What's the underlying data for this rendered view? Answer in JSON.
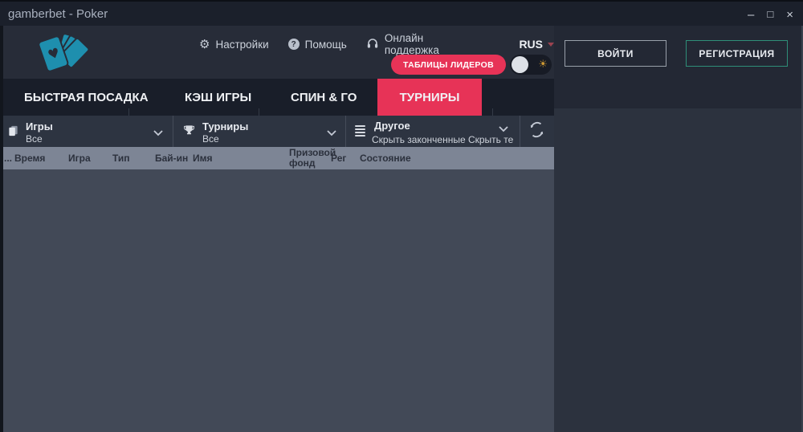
{
  "window": {
    "title": "gamberbet - Poker",
    "controls": {
      "minimize": "–",
      "maximize": "□",
      "close": "×"
    }
  },
  "header": {
    "menu": [
      {
        "icon": "gear-icon",
        "label": "Настройки"
      },
      {
        "icon": "help-icon",
        "help_glyph": "?",
        "label": "Помощь"
      },
      {
        "icon": "headset-icon",
        "label": "Онлайн поддержка"
      }
    ],
    "language": "RUS",
    "leaderboards_label": "ТАБЛИЦЫ ЛИДЕРОВ",
    "login_label": "ВОЙТИ",
    "register_label": "РЕГИСТРАЦИЯ"
  },
  "nav": {
    "tabs": [
      {
        "label": "БЫСТРАЯ ПОСАДКА",
        "active": false
      },
      {
        "label": "КЭШ ИГРЫ",
        "active": false
      },
      {
        "label": "СПИН & ГО",
        "active": false
      },
      {
        "label": "ТУРНИРЫ",
        "active": true
      }
    ]
  },
  "filters": {
    "games": {
      "label": "Игры",
      "value": "Все"
    },
    "tournaments": {
      "label": "Турниры",
      "value": "Все"
    },
    "other": {
      "label": "Другое",
      "value": "Скрыть законченные Скрыть те"
    }
  },
  "table": {
    "columns": [
      "...",
      "Время",
      "Игра",
      "Тип",
      "Бай-ин",
      "Имя",
      "Призовой фонд",
      "Рег",
      "Состояние"
    ],
    "rows": []
  },
  "colors": {
    "accent_red": "#e73357",
    "logo_teal": "#1e8fae",
    "register_border_green": "#2f8f78",
    "sun_orange": "#cf9a33",
    "table_header_gray": "#7d8595"
  }
}
